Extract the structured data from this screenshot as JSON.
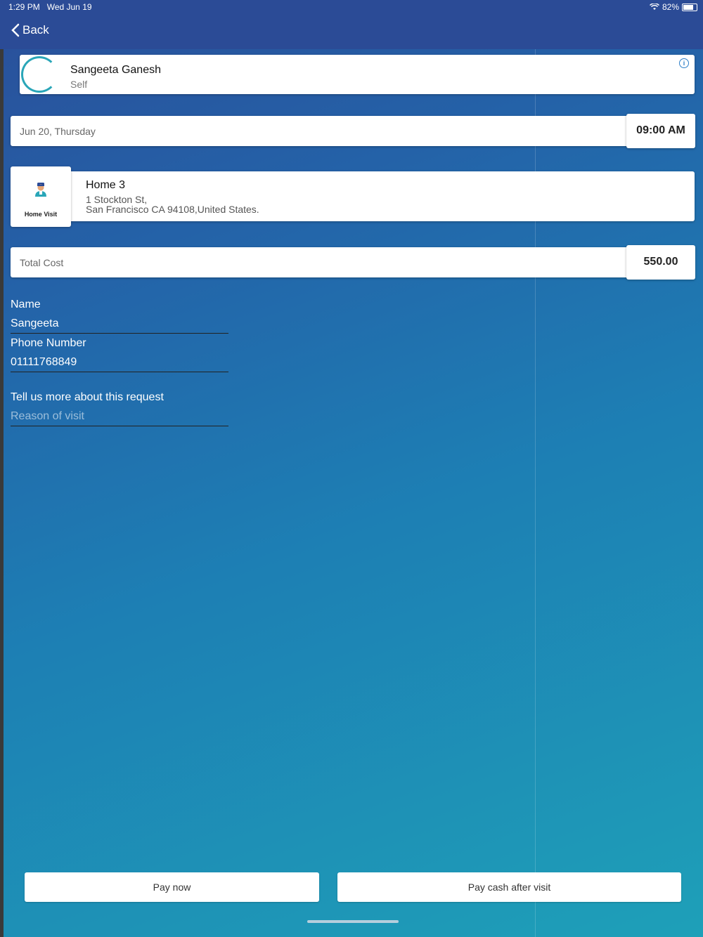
{
  "status": {
    "time": "1:29 PM",
    "date": "Wed Jun 19",
    "battery": "82%"
  },
  "nav": {
    "back_label": "Back"
  },
  "profile": {
    "name": "Sangeeta Ganesh",
    "relation": "Self"
  },
  "schedule": {
    "date": "Jun 20, Thursday",
    "time": "09:00 AM"
  },
  "visit": {
    "type_label": "Home Visit",
    "address_title": "Home 3",
    "address_line1": "1 Stockton St,",
    "address_line2": "San Francisco CA 94108,United States."
  },
  "cost": {
    "label": "Total Cost",
    "value": "550.00"
  },
  "form": {
    "name_label": "Name",
    "name_value": "Sangeeta",
    "phone_label": "Phone Number",
    "phone_value": "01111768849",
    "reason_label": "Tell us more about this request",
    "reason_placeholder": "Reason of visit"
  },
  "buttons": {
    "pay_now": "Pay now",
    "pay_cash": "Pay cash after visit"
  },
  "colors": {
    "accent": "#2aa6b8",
    "bar": "#2b4b96"
  }
}
